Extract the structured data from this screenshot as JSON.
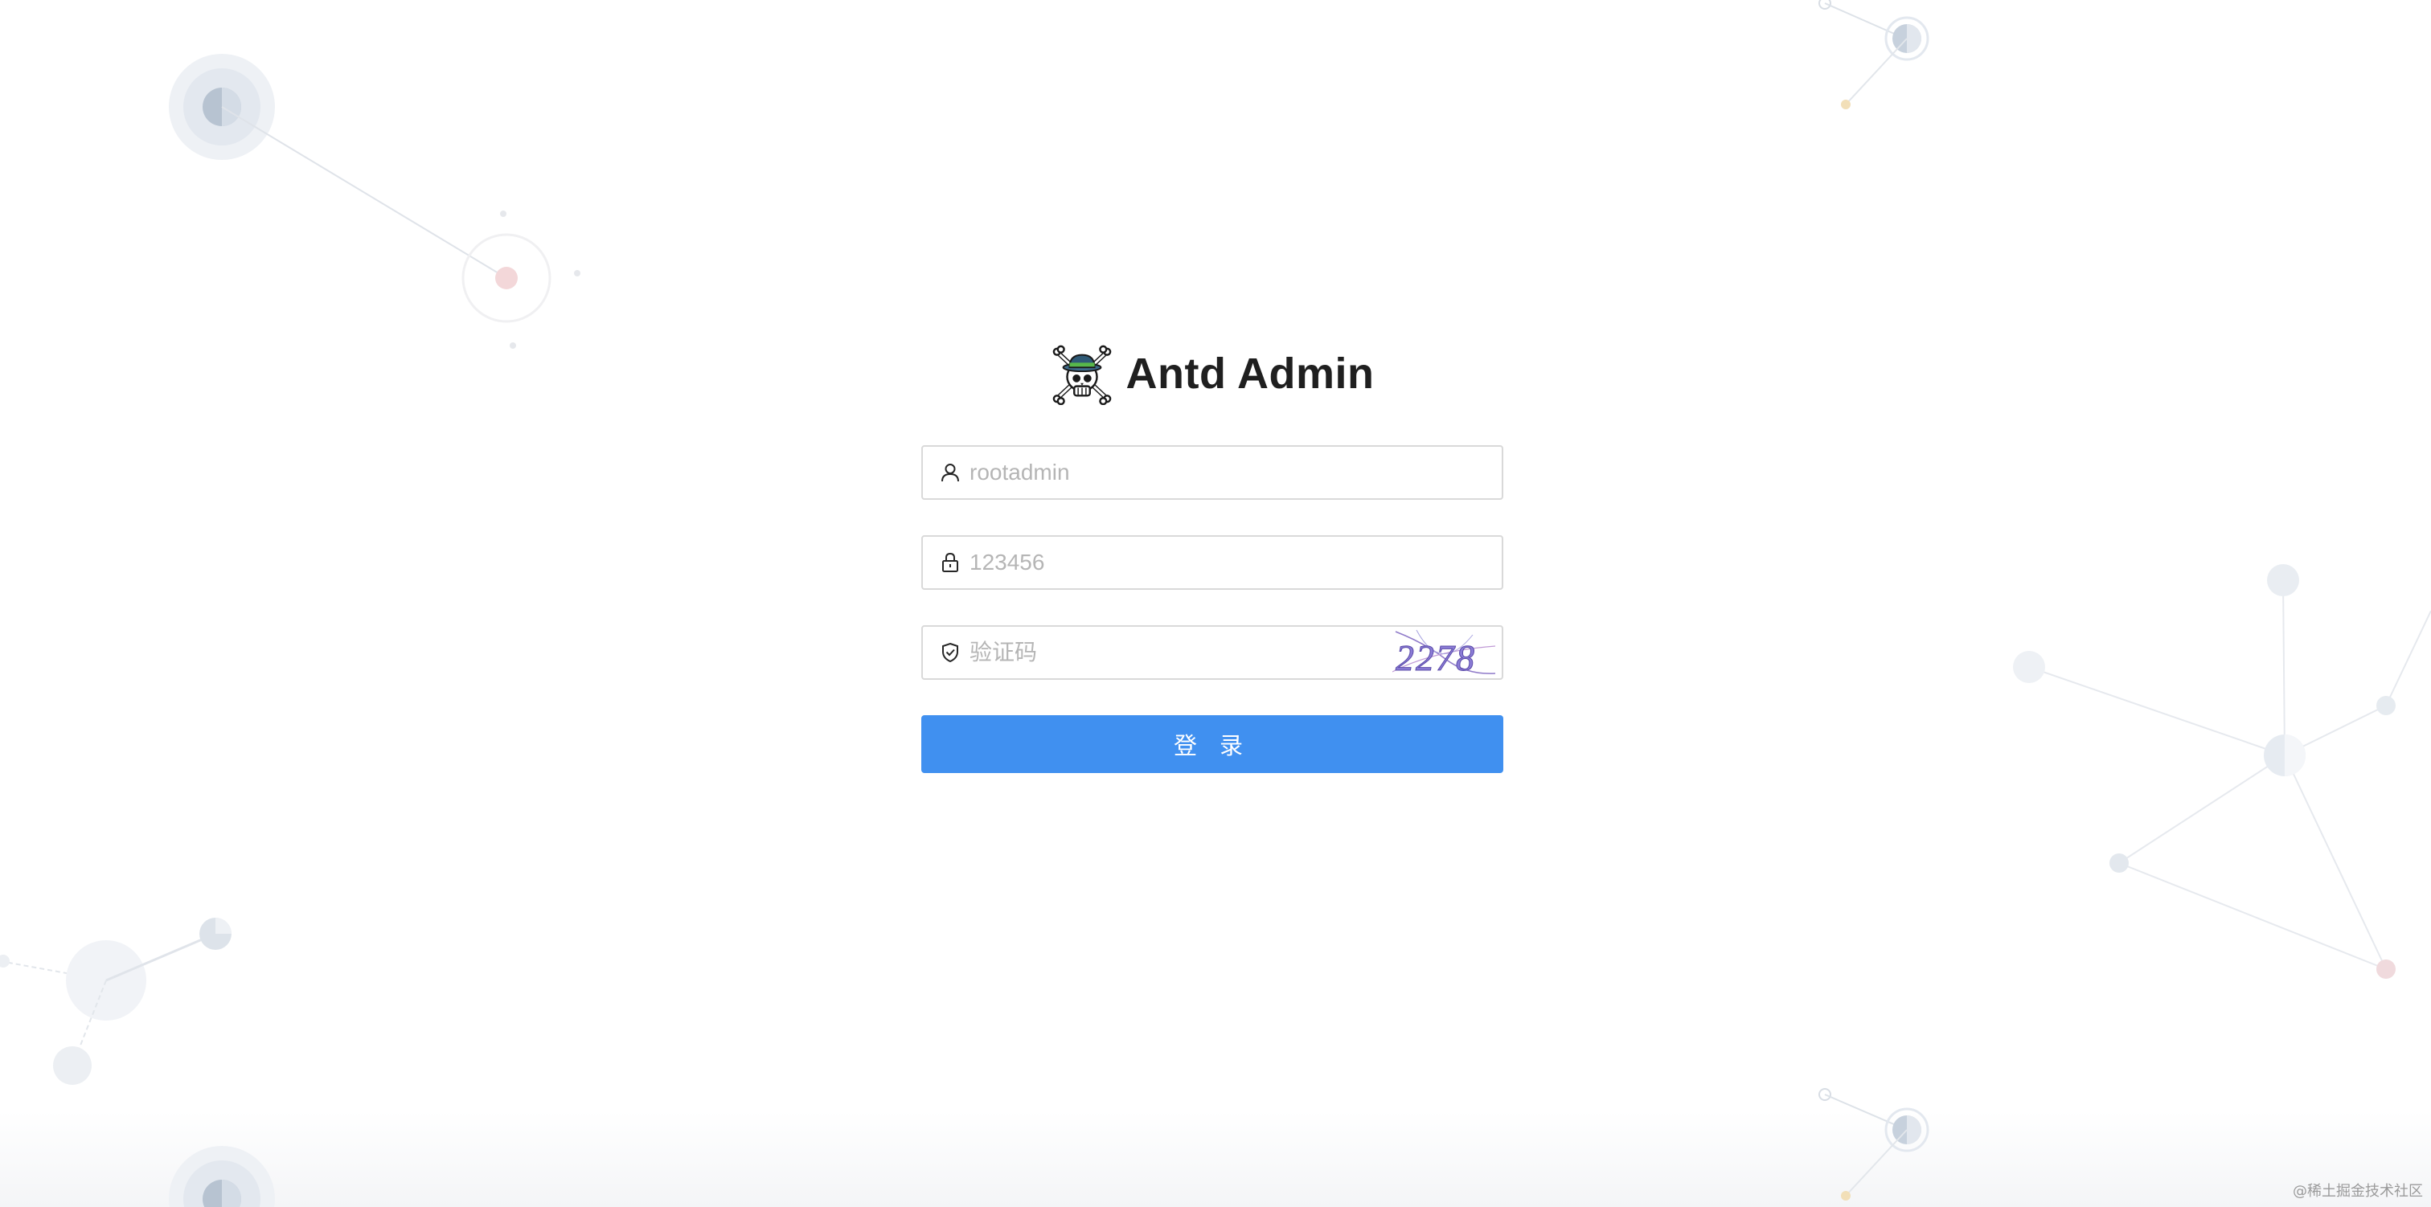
{
  "app": {
    "title": "Antd Admin"
  },
  "form": {
    "username": {
      "value": "",
      "placeholder": "rootadmin",
      "icon": "user-icon"
    },
    "password": {
      "value": "",
      "placeholder": "123456",
      "icon": "lock-icon"
    },
    "captcha": {
      "value": "",
      "placeholder": "验证码",
      "icon": "safety-shield-icon",
      "image_text": "2278"
    },
    "submit_label": "登 录"
  },
  "watermark": "@稀土掘金技术社区",
  "colors": {
    "primary": "#4090f0",
    "border": "#d9d9d9",
    "placeholder": "#b5b5b5",
    "title": "#1f1f1f"
  }
}
